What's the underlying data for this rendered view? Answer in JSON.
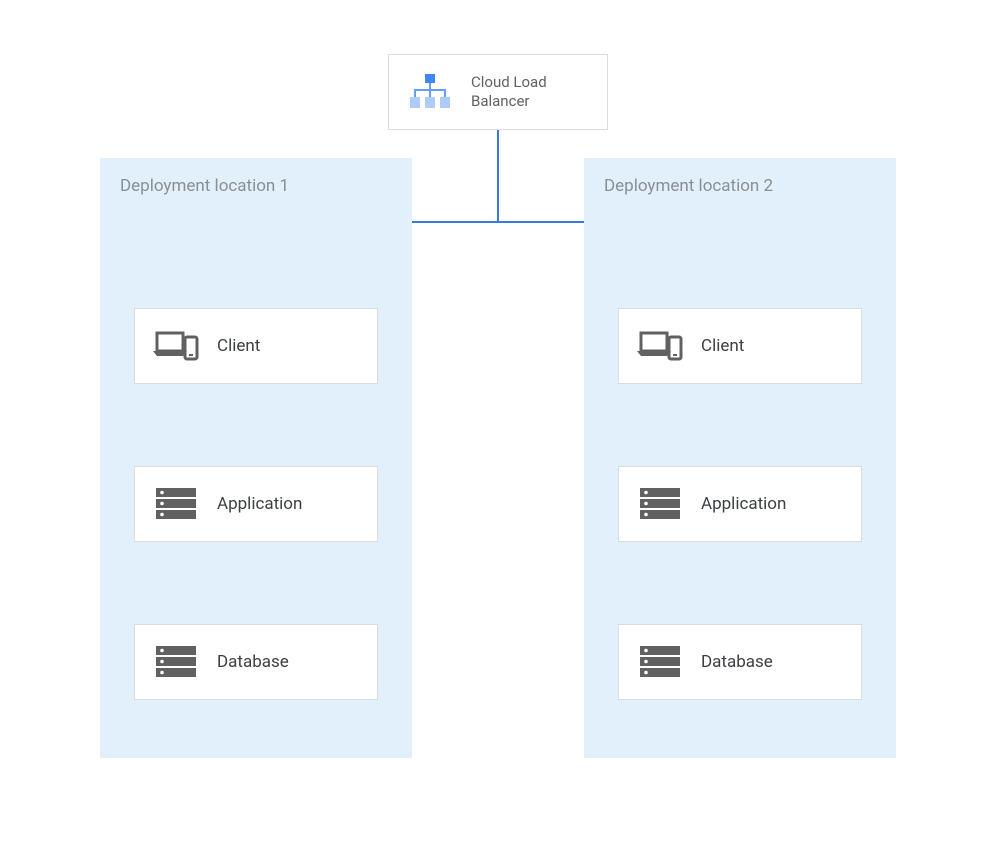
{
  "diagram": {
    "loadBalancer": {
      "label": "Cloud Load Balancer"
    },
    "regions": [
      {
        "label": "Deployment location 1",
        "nodes": {
          "client": "Client",
          "application": "Application",
          "database": "Database"
        }
      },
      {
        "label": "Deployment location 2",
        "nodes": {
          "client": "Client",
          "application": "Application",
          "database": "Database"
        }
      }
    ],
    "colors": {
      "regionBg": "#e1f0fa",
      "nodeBorder": "#dadce0",
      "connector": "#3b78e7",
      "iconGray": "#616161",
      "iconBlue1": "#669df6",
      "iconBlue2": "#4285f4",
      "iconBlue3": "#aecbfa"
    }
  }
}
